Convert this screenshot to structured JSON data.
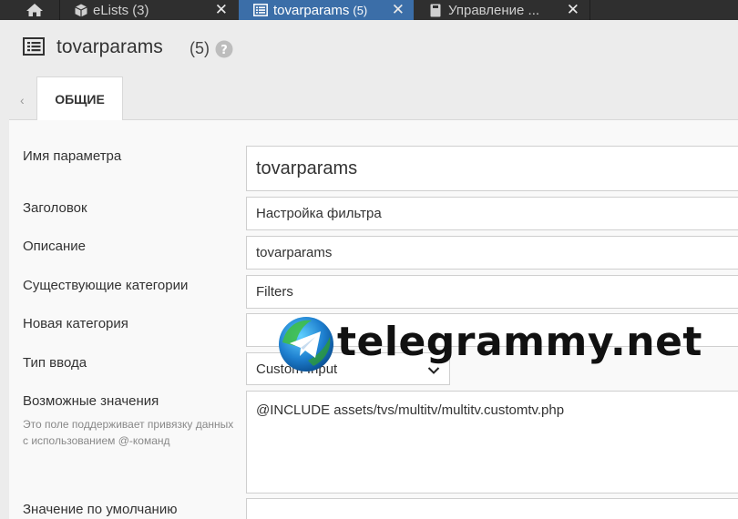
{
  "tabs": [
    {
      "title": "eLists",
      "count": "(3)"
    },
    {
      "title": "tovarparams",
      "count": "(5)"
    },
    {
      "title": "Управление ..."
    }
  ],
  "header": {
    "title": "tovarparams",
    "count": "(5)"
  },
  "section_tabs": {
    "general": "ОБЩИЕ"
  },
  "form": {
    "name_label": "Имя параметра",
    "name_value": "tovarparams",
    "caption_label": "Заголовок",
    "caption_value": "Настройка фильтра",
    "description_label": "Описание",
    "description_value": "tovarparams",
    "existing_categories_label": "Существующие категории",
    "existing_categories_value": "Filters",
    "new_category_label": "Новая категория",
    "new_category_value": "",
    "input_type_label": "Тип ввода",
    "input_type_value": "Custom Input",
    "possible_values_label": "Возможные значения",
    "possible_values_hint": "Это поле поддерживает привязку данных с использованием @-команд",
    "possible_values_value": "@INCLUDE assets/tvs/multitv/multitv.customtv.php",
    "default_value_label": "Значение по умолчанию"
  },
  "watermark": {
    "text": "telegrammy.net"
  },
  "colors": {
    "tabbar": "#2f2f2f",
    "active_tab": "#3b6ea8",
    "background": "#ececec",
    "panel": "#f9f9f9"
  },
  "icons": {
    "home": "home-icon",
    "elists": "cube-icon",
    "active": "list-icon",
    "upr": "document-icon",
    "header": "list-icon",
    "help": "question-icon",
    "select": "chevron-down-icon",
    "watermark": "telegram-logo"
  }
}
